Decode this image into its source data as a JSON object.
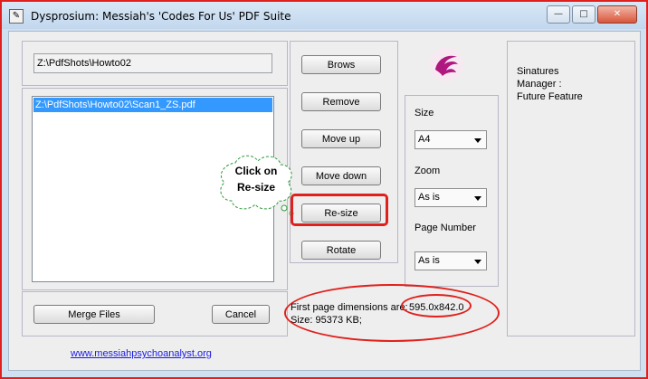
{
  "window": {
    "title": "Dysprosium: Messiah's 'Codes For Us' PDF Suite",
    "controls": {
      "minimize": "—",
      "maximize": "□",
      "close": "✕"
    }
  },
  "left": {
    "path_value": "Z:\\PdfShots\\Howto02",
    "files": [
      "Z:\\PdfShots\\Howto02\\Scan1_ZS.pdf"
    ],
    "merge_label": "Merge Files",
    "cancel_label": "Cancel"
  },
  "actions": {
    "browse": "Brows",
    "remove": "Remove",
    "move_up": "Move up",
    "move_down": "Move down",
    "resize": "Re-size",
    "rotate": "Rotate"
  },
  "options": {
    "size_label": "Size",
    "size_value": "A4",
    "zoom_label": "Zoom",
    "zoom_value": "As is",
    "page_number_label": "Page Number",
    "page_number_value": "As is"
  },
  "info": {
    "first_page_label": "First page dimensions are:",
    "first_page_value": "595.0x842.0",
    "size_text": "Size:  95373 KB;"
  },
  "signatures": {
    "line1": "Sinatures",
    "line2": "Manager :",
    "line3": "Future Feature"
  },
  "callout": {
    "line1": "Click on",
    "line2": "Re-size"
  },
  "footer": {
    "link": "www.messiahpsychoanalyst.org"
  },
  "colors": {
    "annotation_red": "#e0201c",
    "selection": "#3399ff",
    "logo_magenta": "#b0177f"
  }
}
